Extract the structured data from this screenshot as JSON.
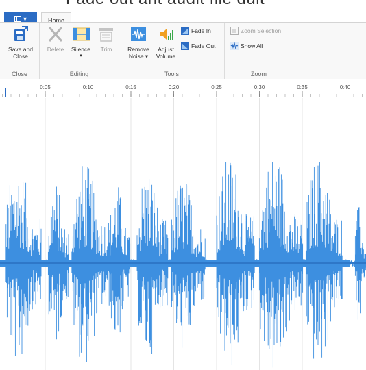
{
  "window": {
    "partial_title": "Fade out ant audit file dult"
  },
  "file_menu": {
    "label": "▾"
  },
  "tabs": [
    {
      "label": "Home"
    }
  ],
  "groups": {
    "close": {
      "label": "Close",
      "buttons": [
        {
          "label_line1": "Save and",
          "label_line2": "Close",
          "icon": "save-icon"
        }
      ]
    },
    "editing": {
      "label": "Editing",
      "buttons": [
        {
          "label": "Delete",
          "icon": "delete-icon",
          "enabled": false
        },
        {
          "label": "Silence",
          "icon": "silence-icon",
          "enabled": true
        },
        {
          "label": "Trim",
          "icon": "trim-icon",
          "enabled": false
        }
      ]
    },
    "tools": {
      "label": "Tools",
      "buttons": [
        {
          "label_line1": "Remove",
          "label_line2": "Noise ▾",
          "icon": "remove-noise-icon"
        },
        {
          "label_line1": "Adjust",
          "label_line2": "Volume",
          "icon": "adjust-volume-icon"
        },
        {
          "label": "Fade In",
          "icon": "fade-in-icon"
        },
        {
          "label": "Fade Out",
          "icon": "fade-out-icon"
        }
      ]
    },
    "zoom": {
      "label": "Zoom",
      "buttons": [
        {
          "label": "Zoom Selection",
          "icon": "zoom-selection-icon",
          "enabled": false
        },
        {
          "label": "Show All",
          "icon": "show-all-icon",
          "enabled": true
        }
      ]
    }
  },
  "ruler": {
    "labels": [
      "0:05",
      "0:10",
      "0:15",
      "0:20",
      "0:25",
      "0:30",
      "0:35",
      "0:40"
    ]
  },
  "colors": {
    "accent": "#2b6cc4",
    "waveform": "#3d8fe0",
    "ribbon_bg": "#f8f8f8"
  }
}
